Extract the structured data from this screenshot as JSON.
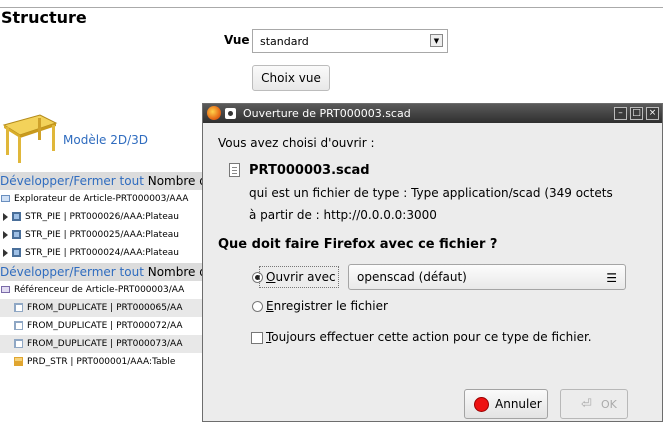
{
  "page": {
    "title": "Structure",
    "vue_label": "Vue",
    "vue_value": "standard",
    "choix_button": "Choix vue",
    "model_link": "Modèle 2D/3D"
  },
  "tree": {
    "sections": [
      {
        "link": "Développer/Fermer tout",
        "text": " Nombre de"
      },
      {
        "link": "Développer/Fermer tout",
        "text": " Nombre de"
      }
    ],
    "rows": [
      "Explorateur de Article-PRT000003/AAA",
      "STR_PIE | PRT000026/AAA:Plateau",
      "STR_PIE | PRT000025/AAA:Plateau",
      "STR_PIE | PRT000024/AAA:Plateau",
      "Référenceur de Article-PRT000003/AA",
      "FROM_DUPLICATE | PRT000065/AA",
      "FROM_DUPLICATE | PRT000072/AA",
      "FROM_DUPLICATE | PRT000073/AA",
      "PRD_STR | PRT000001/AAA:Table"
    ]
  },
  "dialog": {
    "title": "Ouverture de PRT000003.scad",
    "intro": "Vous avez choisi d'ouvrir :",
    "filename": "PRT000003.scad",
    "type_line": "qui est un fichier de type : Type application/scad (349 octets",
    "from_line": "à partir de : http://0.0.0.0:3000",
    "question": "Que doit faire Firefox avec ce fichier ?",
    "open_with_key": "O",
    "open_with_rest": "uvrir avec",
    "app_value": "openscad (défaut)",
    "save_key": "E",
    "save_rest": "nregistrer le fichier",
    "always_key": "T",
    "always_rest": "oujours effectuer cette action pour ce type de fichier.",
    "cancel_label": "Annuler",
    "ok_label": "OK",
    "open_with_selected": true,
    "always_checked": false
  },
  "colors": {
    "link": "#2f6cbf",
    "titlebar": "#3a3a3a",
    "dialog_bg": "#ececec"
  }
}
